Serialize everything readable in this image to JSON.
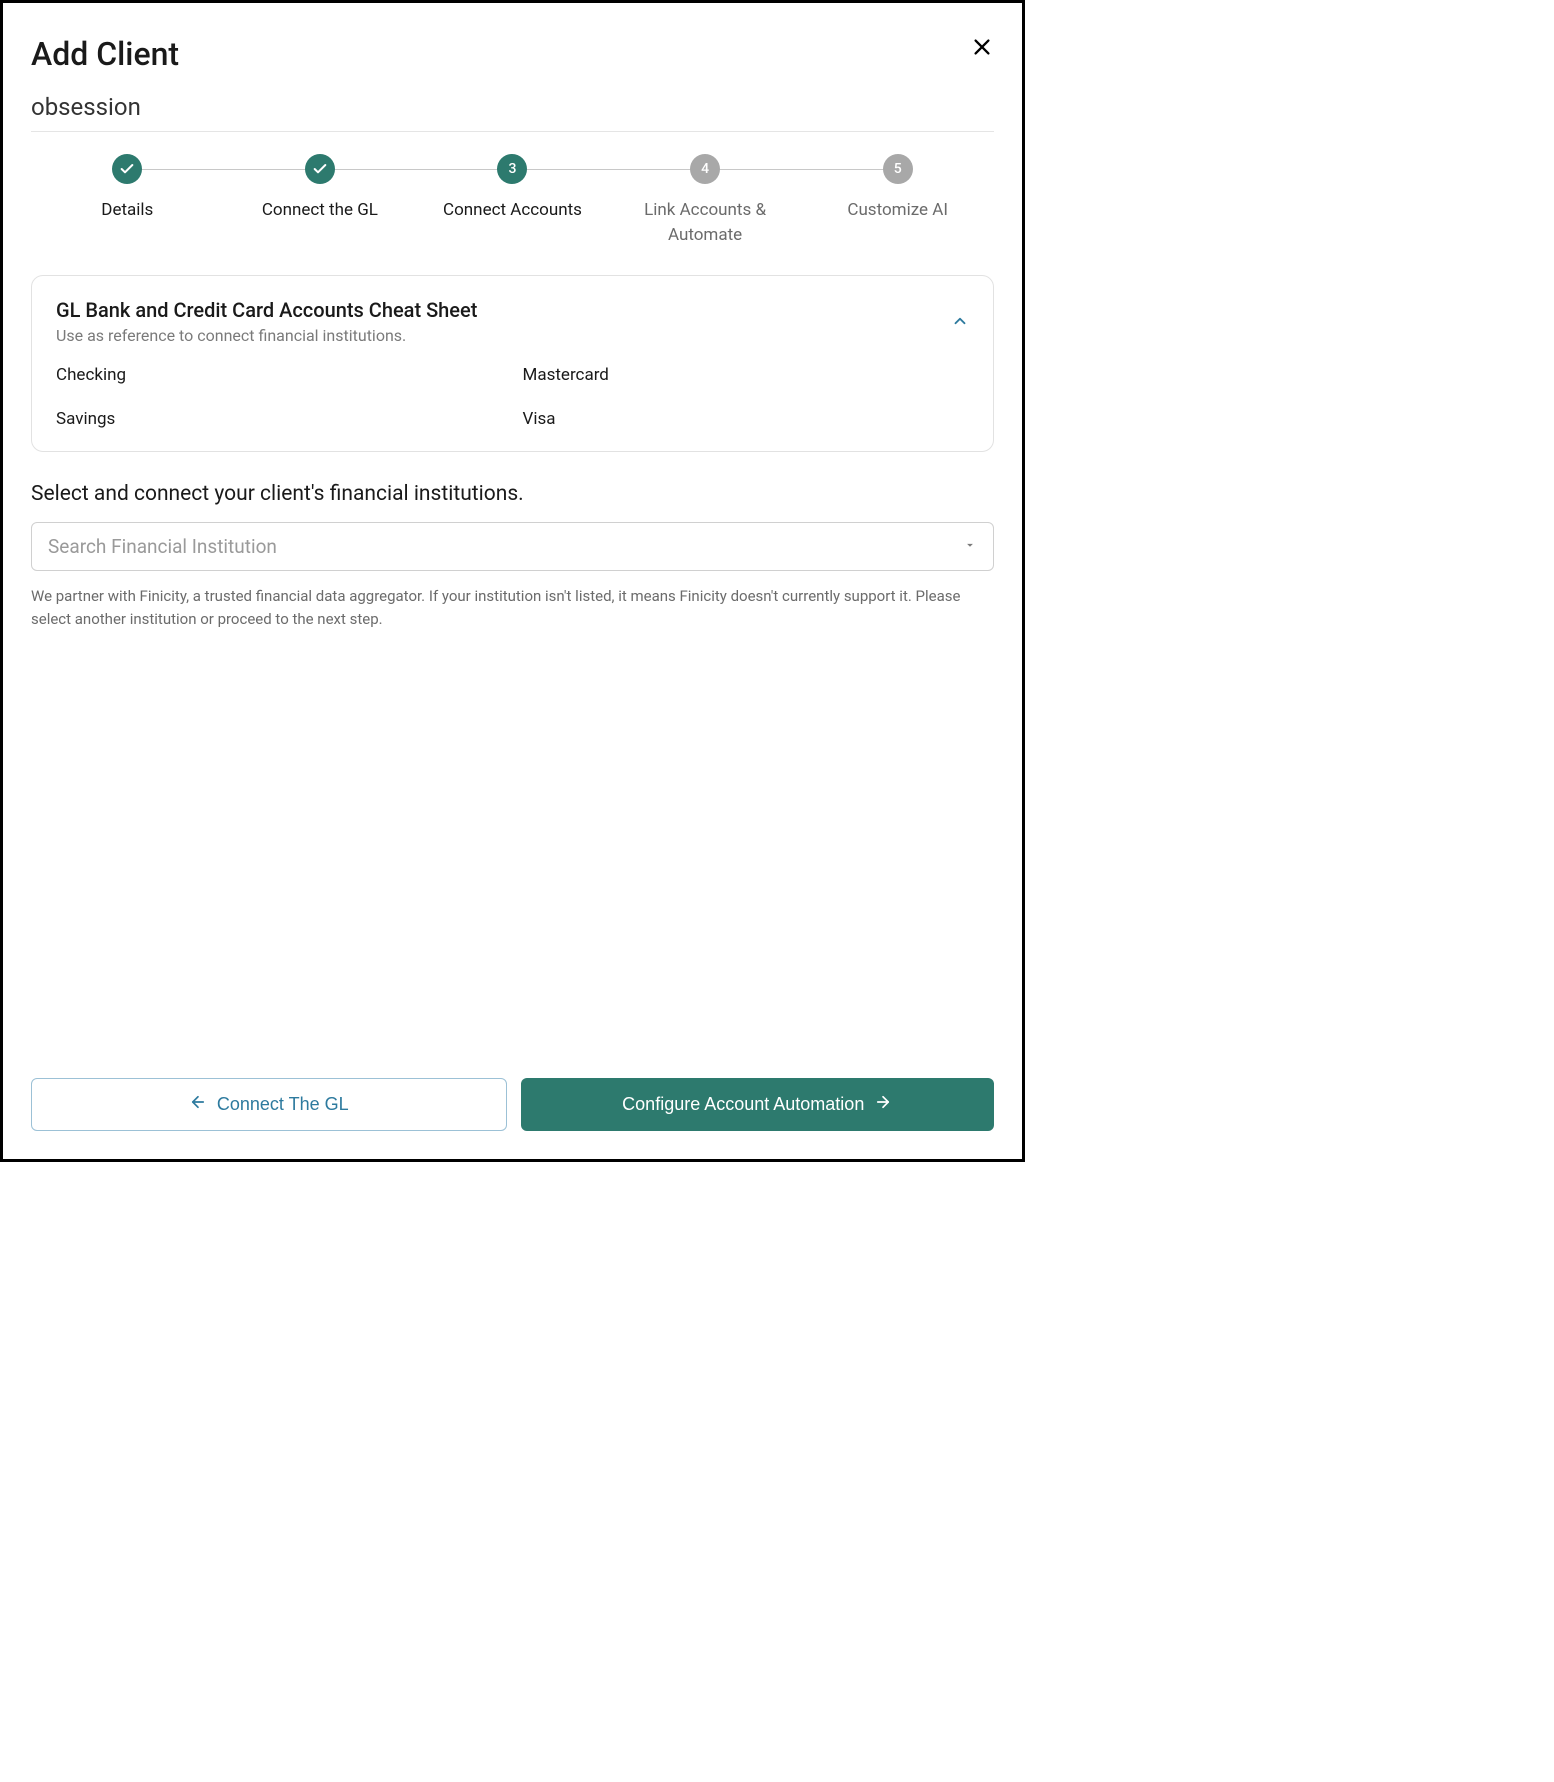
{
  "modal": {
    "title": "Add Client",
    "client_name": "obsession"
  },
  "stepper": {
    "steps": [
      {
        "label": "Details",
        "state": "done"
      },
      {
        "label": "Connect the GL",
        "state": "done"
      },
      {
        "label": "Connect Accounts",
        "state": "active",
        "number": "3"
      },
      {
        "label": "Link Accounts & Automate",
        "state": "pending",
        "number": "4"
      },
      {
        "label": "Customize AI",
        "state": "pending",
        "number": "5"
      }
    ]
  },
  "cheat_sheet": {
    "title": "GL Bank and Credit Card Accounts Cheat Sheet",
    "subtitle": "Use as reference to connect financial institutions.",
    "accounts": [
      "Checking",
      "Mastercard",
      "Savings",
      "Visa"
    ]
  },
  "connect": {
    "heading": "Select and connect your client's financial institutions.",
    "search_placeholder": "Search Financial Institution",
    "helper": "We partner with Finicity, a trusted financial data aggregator. If your institution isn't listed, it means Finicity doesn't currently support it. Please select another institution or proceed to the next step."
  },
  "footer": {
    "back_label": "Connect The GL",
    "next_label": "Configure Account Automation"
  },
  "colors": {
    "primary": "#2d7a6e",
    "link": "#2d7a9e",
    "pending": "#a8a8a8"
  }
}
